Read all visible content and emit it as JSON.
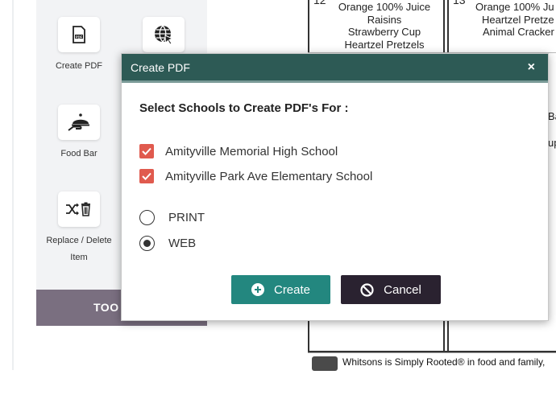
{
  "toolbar": {
    "items": [
      {
        "label": "Create PDF",
        "icon": "pdf-file-icon"
      },
      {
        "label": "",
        "icon": "globe-cursor-icon"
      },
      {
        "label": "Food Bar",
        "icon": "serving-cloche-icon"
      },
      {
        "label_line1": "Replace / Delete",
        "label_line2": "Item",
        "icon": "shuffle-trash-icon"
      }
    ],
    "banner": "TOO"
  },
  "calendar": {
    "day_left": "12",
    "day_right": "13",
    "left_menu": [
      "Orange 100% Juice",
      "Raisins",
      "Strawberry Cup",
      "Heartzel Pretzels"
    ],
    "right_menu": [
      "Orange 100% Ju",
      "Heartzel Pretze",
      "Animal Cracker"
    ],
    "partial_right_1": "Ba",
    "partial_right_2": "up",
    "footer_text": "Whitsons is Simply Rooted® in food and family,"
  },
  "modal": {
    "title": "Create PDF",
    "close": "×",
    "heading": "Select Schools to Create PDF's For :",
    "schools": [
      {
        "label": "Amityville Memorial High School",
        "checked": true
      },
      {
        "label": "Amityville Park Ave Elementary School",
        "checked": true
      }
    ],
    "formats": [
      {
        "label": "PRINT",
        "selected": false
      },
      {
        "label": "WEB",
        "selected": true
      }
    ],
    "create_label": "Create",
    "cancel_label": "Cancel"
  },
  "colors": {
    "header": "#2d5a55",
    "create_button": "#23877f",
    "cancel_button": "#2a2230",
    "checkbox": "#e05a4e",
    "banner": "#7a6f80"
  }
}
